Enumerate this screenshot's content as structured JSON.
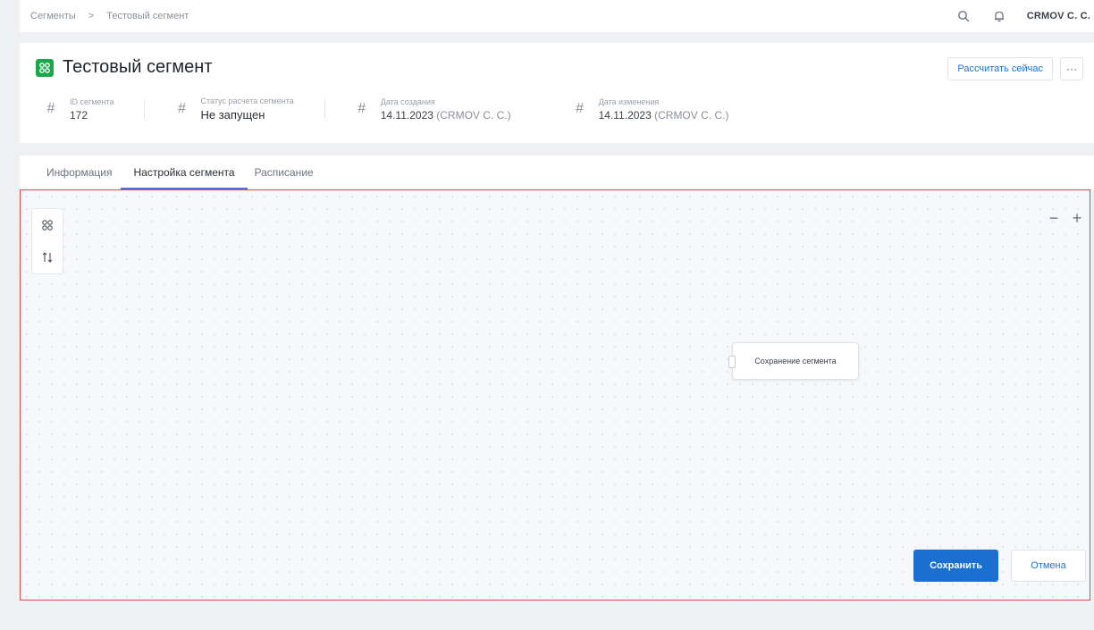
{
  "breadcrumb": {
    "items": [
      "Сегменты",
      "Тестовый сегмент"
    ],
    "separator": ">"
  },
  "topbar": {
    "user_name": "CRMOV C. C.",
    "icons": [
      "search-icon",
      "bell-icon"
    ]
  },
  "header": {
    "title": "Тестовый сегмент",
    "actions": {
      "recalculate_label": "Рассчитать сейчас",
      "more_label": "···"
    },
    "meta": [
      {
        "label": "ID сегмента",
        "value": "172"
      },
      {
        "label": "Статус расчета сегмента",
        "value": "Не запущен"
      },
      {
        "label": "Дата создания",
        "value": "14.11.2023",
        "author": "(CRMOV C. C.)"
      },
      {
        "label": "Дата изменения",
        "value": "14.11.2023",
        "author": "(CRMOV C. C.)"
      }
    ]
  },
  "tabs": [
    {
      "label": "Информация",
      "active": false
    },
    {
      "label": "Настройка сегмента",
      "active": true
    },
    {
      "label": "Расписание",
      "active": false
    }
  ],
  "canvas": {
    "zoom_out_label": "−",
    "zoom_in_label": "+",
    "node_label": "Сохранение сегмента",
    "tools": [
      "grid-icon",
      "sort-icon"
    ]
  },
  "footer": {
    "save_label": "Сохранить",
    "cancel_label": "Отмена"
  },
  "colors": {
    "accent": "#1a6fd0",
    "logo": "#1aa84b",
    "highlight_border": "#e0474c",
    "tab_underline": "#5b6bd6"
  }
}
